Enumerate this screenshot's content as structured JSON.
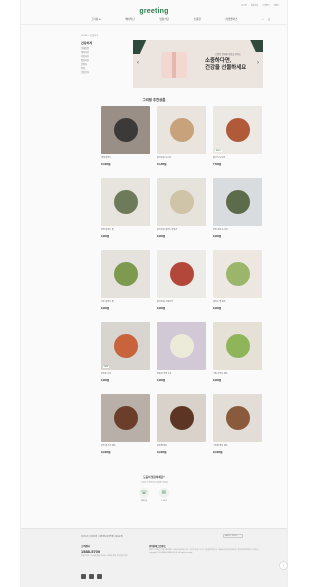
{
  "header": {
    "util_links": [
      "로그인",
      "회원가입",
      "고객센터",
      "이벤트"
    ],
    "logo": "greeting",
    "nav": [
      "그리팅 ≡",
      "케어식단",
      "맞춤식단",
      "소중한",
      "마켓플러스"
    ],
    "icons": [
      "search-icon",
      "cart-icon"
    ]
  },
  "breadcrumb": "HOME > 선물하기",
  "side_menu": {
    "title": "건강하게",
    "items": [
      "전체상품",
      "케어식단",
      "저당식단",
      "맞춤식단",
      "간편식",
      "반찬",
      "건강간식"
    ]
  },
  "banner": {
    "small": "소중한 분에게 마음을 전하는",
    "big_line1": "소중하다면,",
    "big_line2": "건강을 선물하세요",
    "prev": "‹",
    "next": "›"
  },
  "section_title": "그리팅 추천상품",
  "products": [
    {
      "name": "대게 샐러드",
      "price": "15,900원",
      "bg": "#9a8f86",
      "dish": "#3c3a38",
      "badge": ""
    },
    {
      "name": "닭가슴살 도시락",
      "price": "15,200원",
      "bg": "#e9e5de",
      "dish": "#c8a27a",
      "badge": ""
    },
    {
      "name": "불고기 도시락",
      "price": "7,500원",
      "bg": "#ece9e4",
      "dish": "#b05a3a",
      "badge": "BEST"
    },
    {
      "name": "연어 샐러드 볼",
      "price": "9,900원",
      "bg": "#e7e3dd",
      "dish": "#6e7b5a",
      "badge": ""
    },
    {
      "name": "닭가슴살 셀러드 만들기",
      "price": "8,900원",
      "bg": "#e6e2dc",
      "dish": "#cfc3a8",
      "badge": ""
    },
    {
      "name": "우엉 조림 도시락",
      "price": "8,900원",
      "bg": "#d9dcdf",
      "dish": "#5c6b4a",
      "badge": ""
    },
    {
      "name": "가든 샐러드 볼",
      "price": "8,900원",
      "bg": "#e5e2dd",
      "dish": "#7d9a4e",
      "badge": ""
    },
    {
      "name": "닭가슴살 스테이크",
      "price": "8,900원",
      "bg": "#ecebe7",
      "dish": "#b3473a",
      "badge": ""
    },
    {
      "name": "샐러드 랩 세트",
      "price": "8,900원",
      "bg": "#ece8e1",
      "dish": "#9bb56b",
      "badge": ""
    },
    {
      "name": "토마토 수프",
      "price": "6,900원",
      "bg": "#d8d4cf",
      "dish": "#c7643c",
      "badge": "NEW"
    },
    {
      "name": "양송이 크림 수프",
      "price": "6,900원",
      "bg": "#d2c9d6",
      "dish": "#ecead8",
      "badge": ""
    },
    {
      "name": "그린 스무디 세트",
      "price": "8,900원",
      "bg": "#e6e1d6",
      "dish": "#8fb55a",
      "badge": ""
    },
    {
      "name": "한우 불고기 세트",
      "price": "18,900원",
      "bg": "#b8b0a8",
      "dish": "#6a3e2a",
      "badge": ""
    },
    {
      "name": "갈비찜 세트",
      "price": "19,900원",
      "bg": "#d9d2ca",
      "dish": "#5d3524",
      "badge": ""
    },
    {
      "name": "그리팅 정식 세트",
      "price": "22,900원",
      "bg": "#e2ddd6",
      "dish": "#8a5a3c",
      "badge": ""
    }
  ],
  "contact": {
    "title": "도움이 필요하세요?",
    "subtitle": "그리팅 고객센터로 문의해 주세요",
    "buttons": [
      {
        "icon": "phone-icon",
        "glyph": "☏",
        "label": "전화상담"
      },
      {
        "icon": "chat-icon",
        "glyph": "✉",
        "label": "1:1문의"
      }
    ]
  },
  "footer": {
    "links": "회사소개 | 이용약관 | 개인정보처리방침 | 제휴문의",
    "select": "FAMILY SITE ▾",
    "cs_title": "고객센터",
    "cs_phone": "1588-5700",
    "cs_hours": "평일 09:00 ~ 18:00 (점심 12:00 ~ 13:00) 주말 및 공휴일 휴무",
    "company_title": "(주)현대그린푸드",
    "company_info": "대표자 : 박홍진 | 사업자등록번호 : 000-00-00000 | 주소 : 경기도 용인시 수지구 | 통신판매업신고 : 제0000-경기용인-0000호 | 개인정보보호책임자 : 홍길동 | Copyright © HYUNDAI GREEN FOOD. All rights reserved.",
    "top": "↑"
  }
}
